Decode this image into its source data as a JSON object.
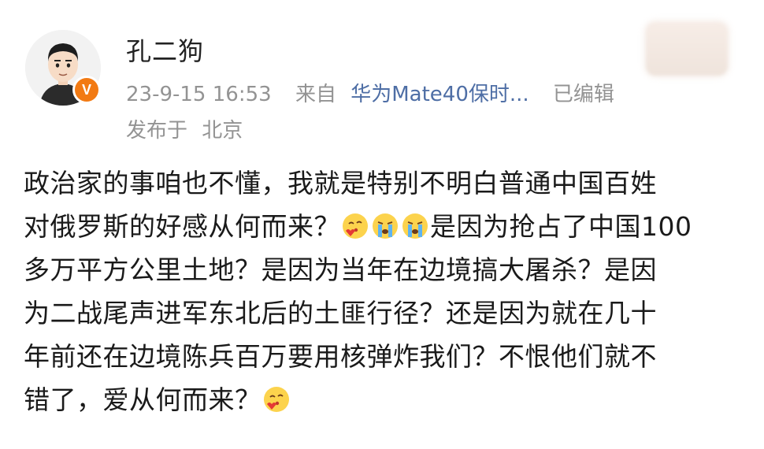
{
  "user": {
    "name": "孔二狗",
    "verified_badge": "V"
  },
  "meta": {
    "time": "23-9-15 16:53",
    "from_label": "来自",
    "device": "华为Mate40保时...",
    "edited": "已编辑",
    "location_label": "发布于",
    "location": "北京"
  },
  "post": {
    "line1": "政治家的事咱也不懂，我就是特别不明白普通中国百姓",
    "line2a": "对俄罗斯的好感从何而来？",
    "line2b": "是因为抢占了中国100",
    "line3": "多万平方公里土地？是因为当年在边境搞大屠杀？是因",
    "line4": "为二战尾声进军东北后的土匪行径？还是因为就在几十",
    "line5": "年前还在边境陈兵百万要用核弹炸我们？不恨他们就不",
    "line6": "错了，爱从何而来？"
  },
  "emojis": {
    "kiss": "kiss-heart-emoji",
    "cry": "crying-face-emoji"
  },
  "colors": {
    "meta_gray": "#939393",
    "link_blue": "#4e6ea5",
    "badge_orange": "#f27a13"
  }
}
